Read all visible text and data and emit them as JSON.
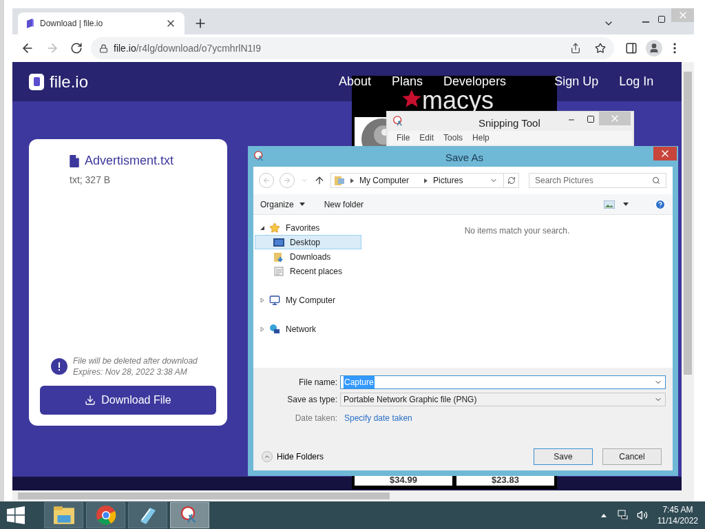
{
  "browser": {
    "tabs": [
      {
        "title": "Download | file.io",
        "selected": true
      }
    ],
    "url_host": "file.io",
    "url_path": "/r4lg/download/o7ycmhrlN1I9"
  },
  "page": {
    "logo": "file.io",
    "nav": [
      {
        "label": "About"
      },
      {
        "label": "Plans"
      },
      {
        "label": "Developers"
      },
      {
        "label": "Sign Up"
      },
      {
        "label": "Log In"
      }
    ],
    "file": {
      "name": "Advertisment.txt",
      "meta": "txt; 327 B"
    },
    "notice": [
      "File will be deleted after download",
      "Expires: Nov 28, 2022 3:38 AM"
    ],
    "download_button": "Download File"
  },
  "shop_window": {
    "logo": "macys",
    "prices": [
      "$34.99",
      "$23.83"
    ]
  },
  "snipping_tool": {
    "title": "Snipping Tool",
    "menu": [
      "File",
      "Edit",
      "Tools",
      "Help"
    ]
  },
  "save_as": {
    "title": "Save As",
    "breadcrumb": [
      "My Computer",
      "Pictures"
    ],
    "search_placeholder": "Search Pictures",
    "toolbar": [
      "Organize",
      "New folder"
    ],
    "tree": [
      {
        "label": "Favorites",
        "kind": "favorites",
        "expanded": true,
        "selected": false,
        "children": [
          {
            "label": "Desktop",
            "kind": "desktop",
            "selected": true
          },
          {
            "label": "Downloads",
            "kind": "downloads",
            "selected": false
          },
          {
            "label": "Recent places",
            "kind": "recent",
            "selected": false
          }
        ]
      },
      {
        "label": "My Computer",
        "kind": "computer",
        "expanded": false,
        "selected": false
      },
      {
        "label": "Network",
        "kind": "network",
        "expanded": false,
        "selected": false
      }
    ],
    "empty_message": "No items match your search.",
    "file_name_label": "File name:",
    "file_name": "Capture",
    "type_label": "Save as type:",
    "type": "Portable Network Graphic file (PNG)",
    "date_label": "Date taken:",
    "date_link": "Specify date taken",
    "hide_folders": "Hide Folders",
    "buttons": [
      "Save",
      "Cancel"
    ]
  },
  "taskbar": {
    "apps": [
      {
        "kind": "explorer",
        "selected": false
      },
      {
        "kind": "chrome",
        "selected": false
      },
      {
        "kind": "notepad",
        "selected": false
      },
      {
        "kind": "snipping",
        "selected": true
      }
    ],
    "time": "7:45 AM",
    "date": "11/14/2022"
  }
}
